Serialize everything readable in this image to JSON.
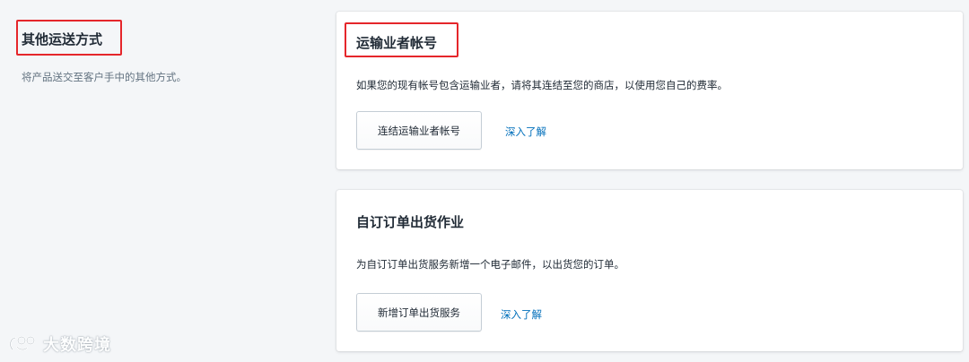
{
  "left": {
    "title": "其他运送方式",
    "description": "将产品送交至客户手中的其他方式。"
  },
  "carrier_card": {
    "title": "运输业者帐号",
    "text": "如果您的现有帐号包含运输业者，请将其连结至您的商店，以使用您自己的费率。",
    "button_label": "连结运输业者帐号",
    "link_label": "深入了解"
  },
  "fulfillment_card": {
    "title": "自订订单出货作业",
    "text": "为自订订单出货服务新增一个电子邮件，以出货您的订单。",
    "button_label": "新增订单出货服务",
    "link_label": "深入了解"
  },
  "watermark": {
    "text": "大数跨境",
    "logo_icon": "logo-icon"
  },
  "colors": {
    "background": "#f4f6f8",
    "card": "#ffffff",
    "link": "#006fbb",
    "highlight": "#e5262b",
    "text": "#212b36",
    "subdued": "#637381"
  }
}
